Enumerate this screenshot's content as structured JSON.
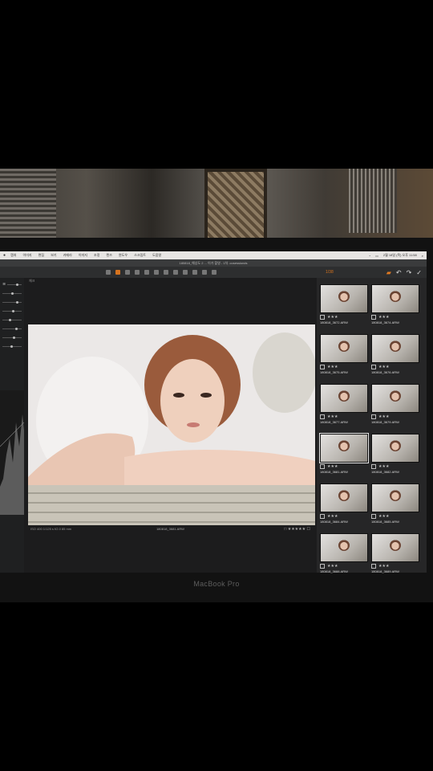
{
  "app": {
    "window_title": "180818_해상도 2 ... 이가 촬영 - 1차 .cosessionds",
    "menubar": {
      "menus": [
        "캡처",
        "이미지",
        "편집",
        "보기",
        "카메라",
        "이미지",
        "조정",
        "렌즈",
        "윈도우",
        "스크립트",
        "도움말"
      ],
      "clock": "2월 18일 (목) 오후 11:58"
    },
    "toolbar": {
      "counter": "1/38"
    },
    "viewer": {
      "label": "체크",
      "caption": "180818_3681.ARW",
      "meta": "ISO 400   1/125 s   f/2.0   85 mm"
    },
    "thumbnails": [
      {
        "name": "180818_3672.ARW",
        "rating": "★★★"
      },
      {
        "name": "180818_3674.ARW",
        "rating": "★★★"
      },
      {
        "name": "180818_3675.ARW",
        "rating": "★★★"
      },
      {
        "name": "180818_3676.ARW",
        "rating": "★★★"
      },
      {
        "name": "180818_3677.ARW",
        "rating": "★★★"
      },
      {
        "name": "180818_3679.ARW",
        "rating": "★★★"
      },
      {
        "name": "180818_3681.ARW",
        "rating": "★★★"
      },
      {
        "name": "180818_3682.ARW",
        "rating": "★★★"
      },
      {
        "name": "180818_3684.ARW",
        "rating": "★★★"
      },
      {
        "name": "180818_3685.ARW",
        "rating": "★★★"
      },
      {
        "name": "180818_3688.ARW",
        "rating": "★★★"
      },
      {
        "name": "180818_3689.ARW",
        "rating": "★★★"
      }
    ]
  },
  "hardware": {
    "laptop_label": "MacBook Pro"
  },
  "colors": {
    "accent": "#d6731f",
    "panel": "#242526"
  }
}
